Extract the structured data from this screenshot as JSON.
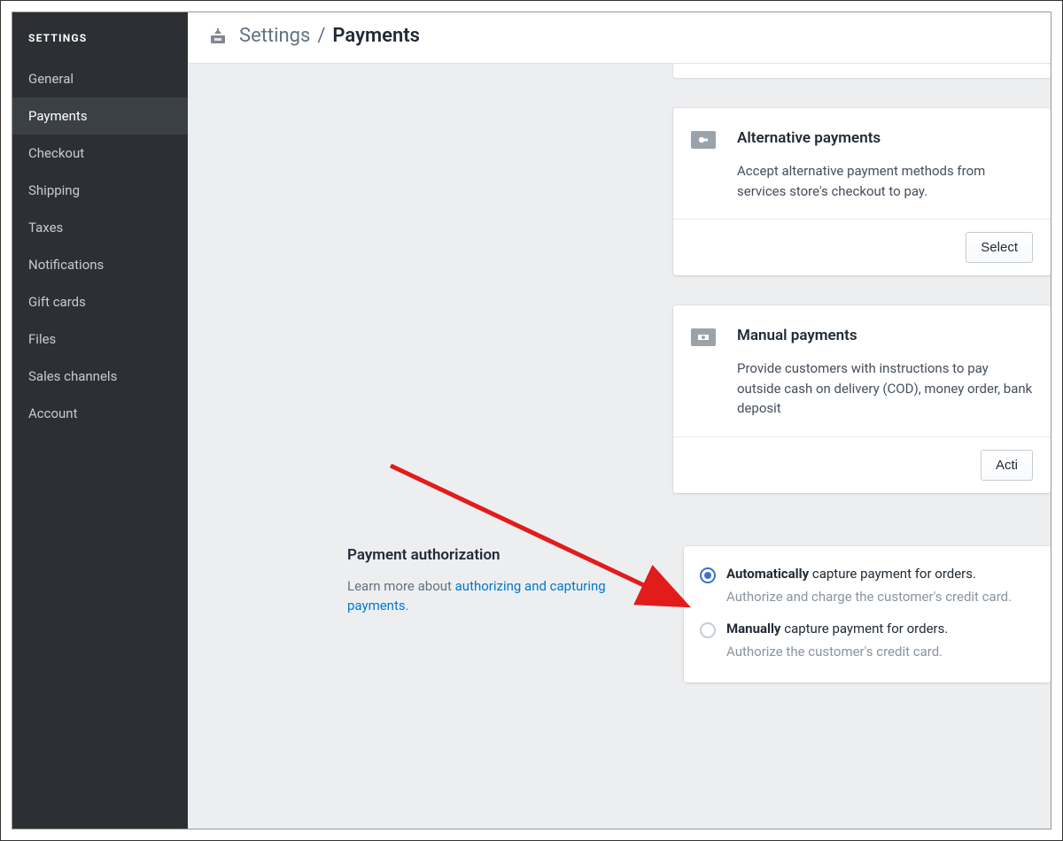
{
  "sidebar": {
    "header": "SETTINGS",
    "items": [
      {
        "label": "General"
      },
      {
        "label": "Payments",
        "active": true
      },
      {
        "label": "Checkout"
      },
      {
        "label": "Shipping"
      },
      {
        "label": "Taxes"
      },
      {
        "label": "Notifications"
      },
      {
        "label": "Gift cards"
      },
      {
        "label": "Files"
      },
      {
        "label": "Sales channels"
      },
      {
        "label": "Account"
      }
    ]
  },
  "breadcrumb": {
    "root": "Settings",
    "sep": "/",
    "current": "Payments"
  },
  "cards": {
    "alternative": {
      "title": "Alternative payments",
      "desc": "Accept alternative payment methods from services store's checkout to pay.",
      "button": "Select"
    },
    "manual": {
      "title": "Manual payments",
      "desc": "Provide customers with instructions to pay outside cash on delivery (COD), money order, bank deposit",
      "button": "Acti"
    }
  },
  "auth_section": {
    "heading": "Payment authorization",
    "learn_prefix": "Learn more about ",
    "learn_link": "authorizing and capturing payments",
    "learn_suffix": ".",
    "options": [
      {
        "strong": "Automatically",
        "rest": " capture payment for orders.",
        "help": "Authorize and charge the customer's credit card.",
        "selected": true
      },
      {
        "strong": "Manually",
        "rest": " capture payment for orders.",
        "help": "Authorize the customer's credit card.",
        "selected": false
      }
    ]
  },
  "colors": {
    "arrow": "#e21b1b",
    "link": "#007ace"
  }
}
